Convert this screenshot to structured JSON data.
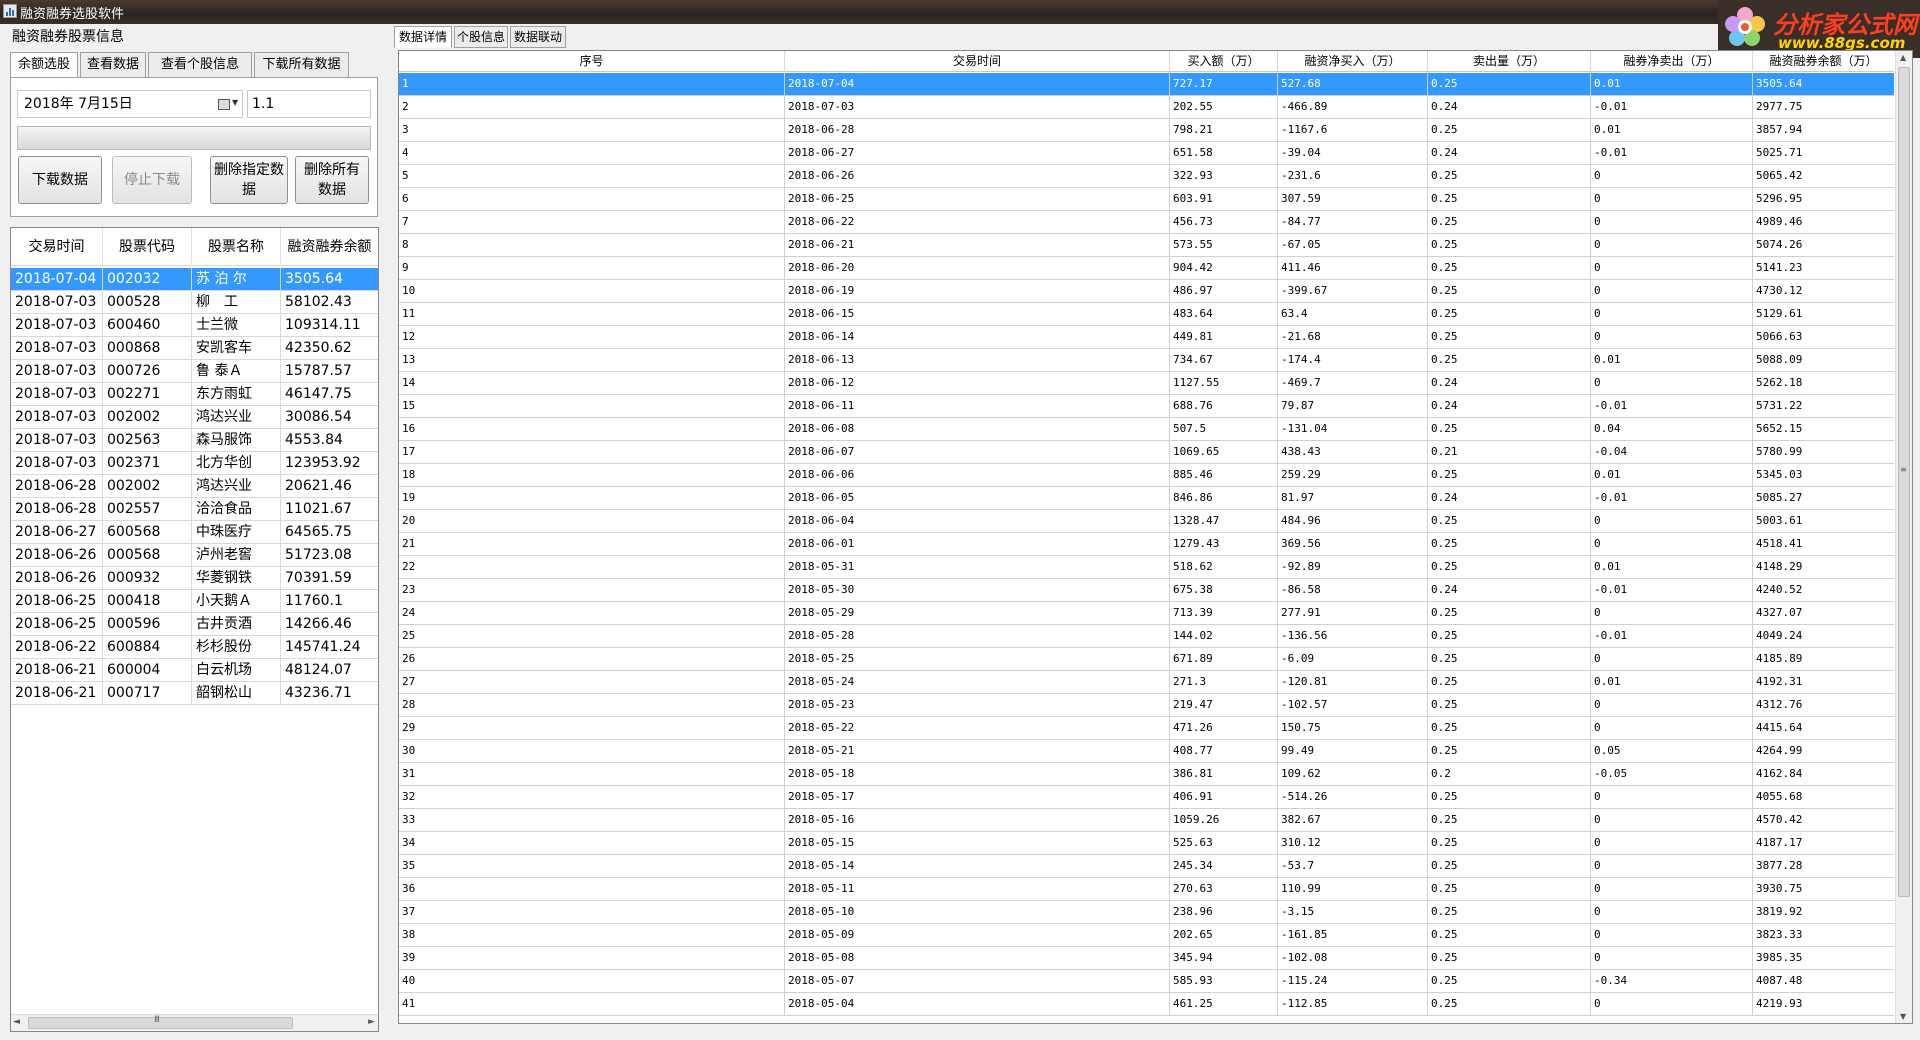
{
  "window": {
    "title": "融资融券选股软件"
  },
  "logo": {
    "line1": "分析家公式网",
    "line2": "www.88gs.com"
  },
  "left": {
    "panel_title": "融资融券股票信息",
    "tabs": [
      {
        "label": "余额选股",
        "active": true
      },
      {
        "label": "查看数据",
        "active": false
      },
      {
        "label": "查看个股信息",
        "active": false
      },
      {
        "label": "下载所有数据",
        "active": false
      }
    ],
    "date_value": "2018年  7月15日",
    "number_value": "1.1",
    "buttons": {
      "download": "下载数据",
      "stop": "停止下载",
      "delete_selected": "删除指定数据",
      "delete_all": "删除所有数据"
    },
    "grid": {
      "columns": [
        "交易时间",
        "股票代码",
        "股票名称",
        "融资融券余额"
      ],
      "rows": [
        [
          "2018-07-04",
          "002032",
          "苏 泊 尔",
          "3505.64"
        ],
        [
          "2018-07-03",
          "000528",
          "柳　工",
          "58102.43"
        ],
        [
          "2018-07-03",
          "600460",
          "士兰微",
          "109314.11"
        ],
        [
          "2018-07-03",
          "000868",
          "安凯客车",
          "42350.62"
        ],
        [
          "2018-07-03",
          "000726",
          "鲁 泰Ａ",
          "15787.57"
        ],
        [
          "2018-07-03",
          "002271",
          "东方雨虹",
          "46147.75"
        ],
        [
          "2018-07-03",
          "002002",
          "鸿达兴业",
          "30086.54"
        ],
        [
          "2018-07-03",
          "002563",
          "森马服饰",
          "4553.84"
        ],
        [
          "2018-07-03",
          "002371",
          "北方华创",
          "123953.92"
        ],
        [
          "2018-06-28",
          "002002",
          "鸿达兴业",
          "20621.46"
        ],
        [
          "2018-06-28",
          "002557",
          "洽洽食品",
          "11021.67"
        ],
        [
          "2018-06-27",
          "600568",
          "中珠医疗",
          "64565.75"
        ],
        [
          "2018-06-26",
          "000568",
          "泸州老窖",
          "51723.08"
        ],
        [
          "2018-06-26",
          "000932",
          "华菱钢铁",
          "70391.59"
        ],
        [
          "2018-06-25",
          "000418",
          "小天鹅Ａ",
          "11760.1"
        ],
        [
          "2018-06-25",
          "000596",
          "古井贡酒",
          "14266.46"
        ],
        [
          "2018-06-22",
          "600884",
          "杉杉股份",
          "145741.24"
        ],
        [
          "2018-06-21",
          "600004",
          "白云机场",
          "48124.07"
        ],
        [
          "2018-06-21",
          "000717",
          "韶钢松山",
          "43236.71"
        ]
      ]
    }
  },
  "right": {
    "tabs": [
      {
        "label": "数据详情",
        "active": true
      },
      {
        "label": "个股信息",
        "active": false
      },
      {
        "label": "数据联动",
        "active": false
      }
    ],
    "grid": {
      "columns": [
        "序号",
        "交易时间",
        "买入额（万）",
        "融资净买入（万）",
        "卖出量（万）",
        "融券净卖出（万）",
        "融资融券余额（万）"
      ],
      "rows": [
        [
          "1",
          "2018-07-04",
          "727.17",
          "527.68",
          "0.25",
          "0.01",
          "3505.64"
        ],
        [
          "2",
          "2018-07-03",
          "202.55",
          "-466.89",
          "0.24",
          "-0.01",
          "2977.75"
        ],
        [
          "3",
          "2018-06-28",
          "798.21",
          "-1167.6",
          "0.25",
          "0.01",
          "3857.94"
        ],
        [
          "4",
          "2018-06-27",
          "651.58",
          "-39.04",
          "0.24",
          "-0.01",
          "5025.71"
        ],
        [
          "5",
          "2018-06-26",
          "322.93",
          "-231.6",
          "0.25",
          "0",
          "5065.42"
        ],
        [
          "6",
          "2018-06-25",
          "603.91",
          "307.59",
          "0.25",
          "0",
          "5296.95"
        ],
        [
          "7",
          "2018-06-22",
          "456.73",
          "-84.77",
          "0.25",
          "0",
          "4989.46"
        ],
        [
          "8",
          "2018-06-21",
          "573.55",
          "-67.05",
          "0.25",
          "0",
          "5074.26"
        ],
        [
          "9",
          "2018-06-20",
          "904.42",
          "411.46",
          "0.25",
          "0",
          "5141.23"
        ],
        [
          "10",
          "2018-06-19",
          "486.97",
          "-399.67",
          "0.25",
          "0",
          "4730.12"
        ],
        [
          "11",
          "2018-06-15",
          "483.64",
          "63.4",
          "0.25",
          "0",
          "5129.61"
        ],
        [
          "12",
          "2018-06-14",
          "449.81",
          "-21.68",
          "0.25",
          "0",
          "5066.63"
        ],
        [
          "13",
          "2018-06-13",
          "734.67",
          "-174.4",
          "0.25",
          "0.01",
          "5088.09"
        ],
        [
          "14",
          "2018-06-12",
          "1127.55",
          "-469.7",
          "0.24",
          "0",
          "5262.18"
        ],
        [
          "15",
          "2018-06-11",
          "688.76",
          "79.87",
          "0.24",
          "-0.01",
          "5731.22"
        ],
        [
          "16",
          "2018-06-08",
          "507.5",
          "-131.04",
          "0.25",
          "0.04",
          "5652.15"
        ],
        [
          "17",
          "2018-06-07",
          "1069.65",
          "438.43",
          "0.21",
          "-0.04",
          "5780.99"
        ],
        [
          "18",
          "2018-06-06",
          "885.46",
          "259.29",
          "0.25",
          "0.01",
          "5345.03"
        ],
        [
          "19",
          "2018-06-05",
          "846.86",
          "81.97",
          "0.24",
          "-0.01",
          "5085.27"
        ],
        [
          "20",
          "2018-06-04",
          "1328.47",
          "484.96",
          "0.25",
          "0",
          "5003.61"
        ],
        [
          "21",
          "2018-06-01",
          "1279.43",
          "369.56",
          "0.25",
          "0",
          "4518.41"
        ],
        [
          "22",
          "2018-05-31",
          "518.62",
          "-92.89",
          "0.25",
          "0.01",
          "4148.29"
        ],
        [
          "23",
          "2018-05-30",
          "675.38",
          "-86.58",
          "0.24",
          "-0.01",
          "4240.52"
        ],
        [
          "24",
          "2018-05-29",
          "713.39",
          "277.91",
          "0.25",
          "0",
          "4327.07"
        ],
        [
          "25",
          "2018-05-28",
          "144.02",
          "-136.56",
          "0.25",
          "-0.01",
          "4049.24"
        ],
        [
          "26",
          "2018-05-25",
          "671.89",
          "-6.09",
          "0.25",
          "0",
          "4185.89"
        ],
        [
          "27",
          "2018-05-24",
          "271.3",
          "-120.81",
          "0.25",
          "0.01",
          "4192.31"
        ],
        [
          "28",
          "2018-05-23",
          "219.47",
          "-102.57",
          "0.25",
          "0",
          "4312.76"
        ],
        [
          "29",
          "2018-05-22",
          "471.26",
          "150.75",
          "0.25",
          "0",
          "4415.64"
        ],
        [
          "30",
          "2018-05-21",
          "408.77",
          "99.49",
          "0.25",
          "0.05",
          "4264.99"
        ],
        [
          "31",
          "2018-05-18",
          "386.81",
          "109.62",
          "0.2",
          "-0.05",
          "4162.84"
        ],
        [
          "32",
          "2018-05-17",
          "406.91",
          "-514.26",
          "0.25",
          "0",
          "4055.68"
        ],
        [
          "33",
          "2018-05-16",
          "1059.26",
          "382.67",
          "0.25",
          "0",
          "4570.42"
        ],
        [
          "34",
          "2018-05-15",
          "525.63",
          "310.12",
          "0.25",
          "0",
          "4187.17"
        ],
        [
          "35",
          "2018-05-14",
          "245.34",
          "-53.7",
          "0.25",
          "0",
          "3877.28"
        ],
        [
          "36",
          "2018-05-11",
          "270.63",
          "110.99",
          "0.25",
          "0",
          "3930.75"
        ],
        [
          "37",
          "2018-05-10",
          "238.96",
          "-3.15",
          "0.25",
          "0",
          "3819.92"
        ],
        [
          "38",
          "2018-05-09",
          "202.65",
          "-161.85",
          "0.25",
          "0",
          "3823.33"
        ],
        [
          "39",
          "2018-05-08",
          "345.94",
          "-102.08",
          "0.25",
          "0",
          "3985.35"
        ],
        [
          "40",
          "2018-05-07",
          "585.93",
          "-115.24",
          "0.25",
          "-0.34",
          "4087.48"
        ],
        [
          "41",
          "2018-05-04",
          "461.25",
          "-112.85",
          "0.25",
          "0",
          "4219.93"
        ]
      ]
    }
  },
  "colors": {
    "selection": "#3399ff",
    "title_bar": "#2b2420"
  }
}
